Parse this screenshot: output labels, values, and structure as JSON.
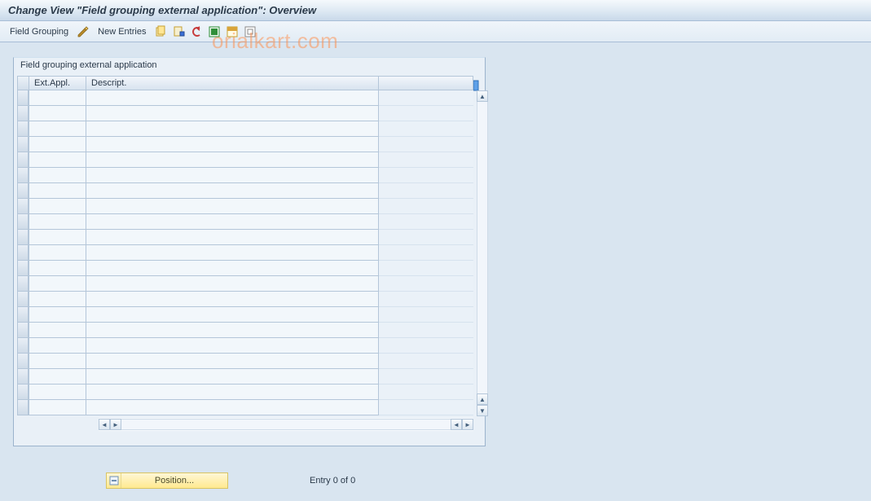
{
  "title": "Change View \"Field grouping external application\": Overview",
  "toolbar": {
    "field_grouping": "Field Grouping",
    "new_entries": "New Entries",
    "icons": {
      "change": "change-icon",
      "copy": "copy-icon",
      "delete": "delete-icon",
      "undo": "undo-icon",
      "select_all": "select-all-icon",
      "select_block": "select-block-icon",
      "deselect_all": "deselect-all-icon"
    }
  },
  "watermark": "orialkart.com",
  "panel": {
    "title": "Field grouping external application",
    "columns": {
      "c1": "Ext.Appl.",
      "c2": "Descript."
    },
    "config_icon": "table-settings-icon",
    "row_count": 21
  },
  "footer": {
    "position_label": "Position...",
    "entry_text": "Entry 0 of 0"
  }
}
